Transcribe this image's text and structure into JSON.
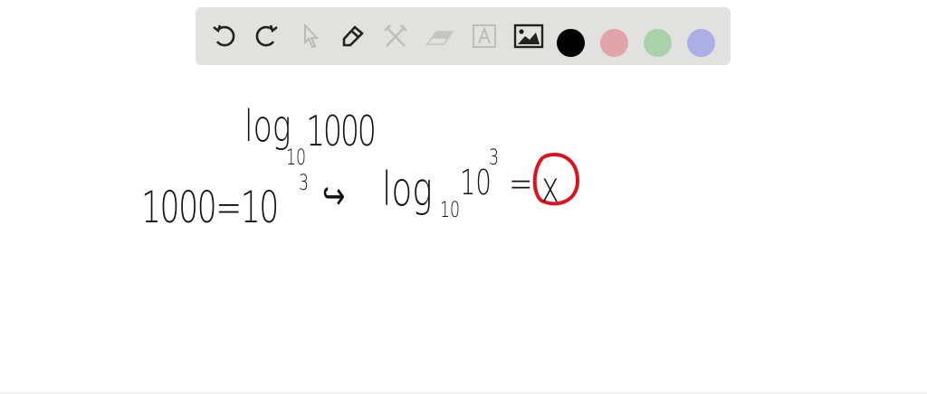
{
  "toolbar": {
    "tools": [
      {
        "name": "undo",
        "enabled": true
      },
      {
        "name": "redo",
        "enabled": true
      },
      {
        "name": "select",
        "enabled": false
      },
      {
        "name": "pen",
        "enabled": true
      },
      {
        "name": "tools",
        "enabled": false
      },
      {
        "name": "eraser",
        "enabled": false
      },
      {
        "name": "text",
        "enabled": false
      },
      {
        "name": "image",
        "enabled": true
      }
    ],
    "colors": [
      "#000000",
      "#e3a3ab",
      "#a9d1aa",
      "#aeaee6"
    ]
  },
  "canvas": {
    "line1": {
      "log": "log",
      "base": "10",
      "arg": "1000"
    },
    "line2": {
      "lhs": "1000=10",
      "exp": "3",
      "arrow": "↪",
      "log": "log",
      "base": "10",
      "arg": "10",
      "arg_exp": "3",
      "eq": "=",
      "answer": "x"
    },
    "answer_circle_color": "#e0101e"
  }
}
